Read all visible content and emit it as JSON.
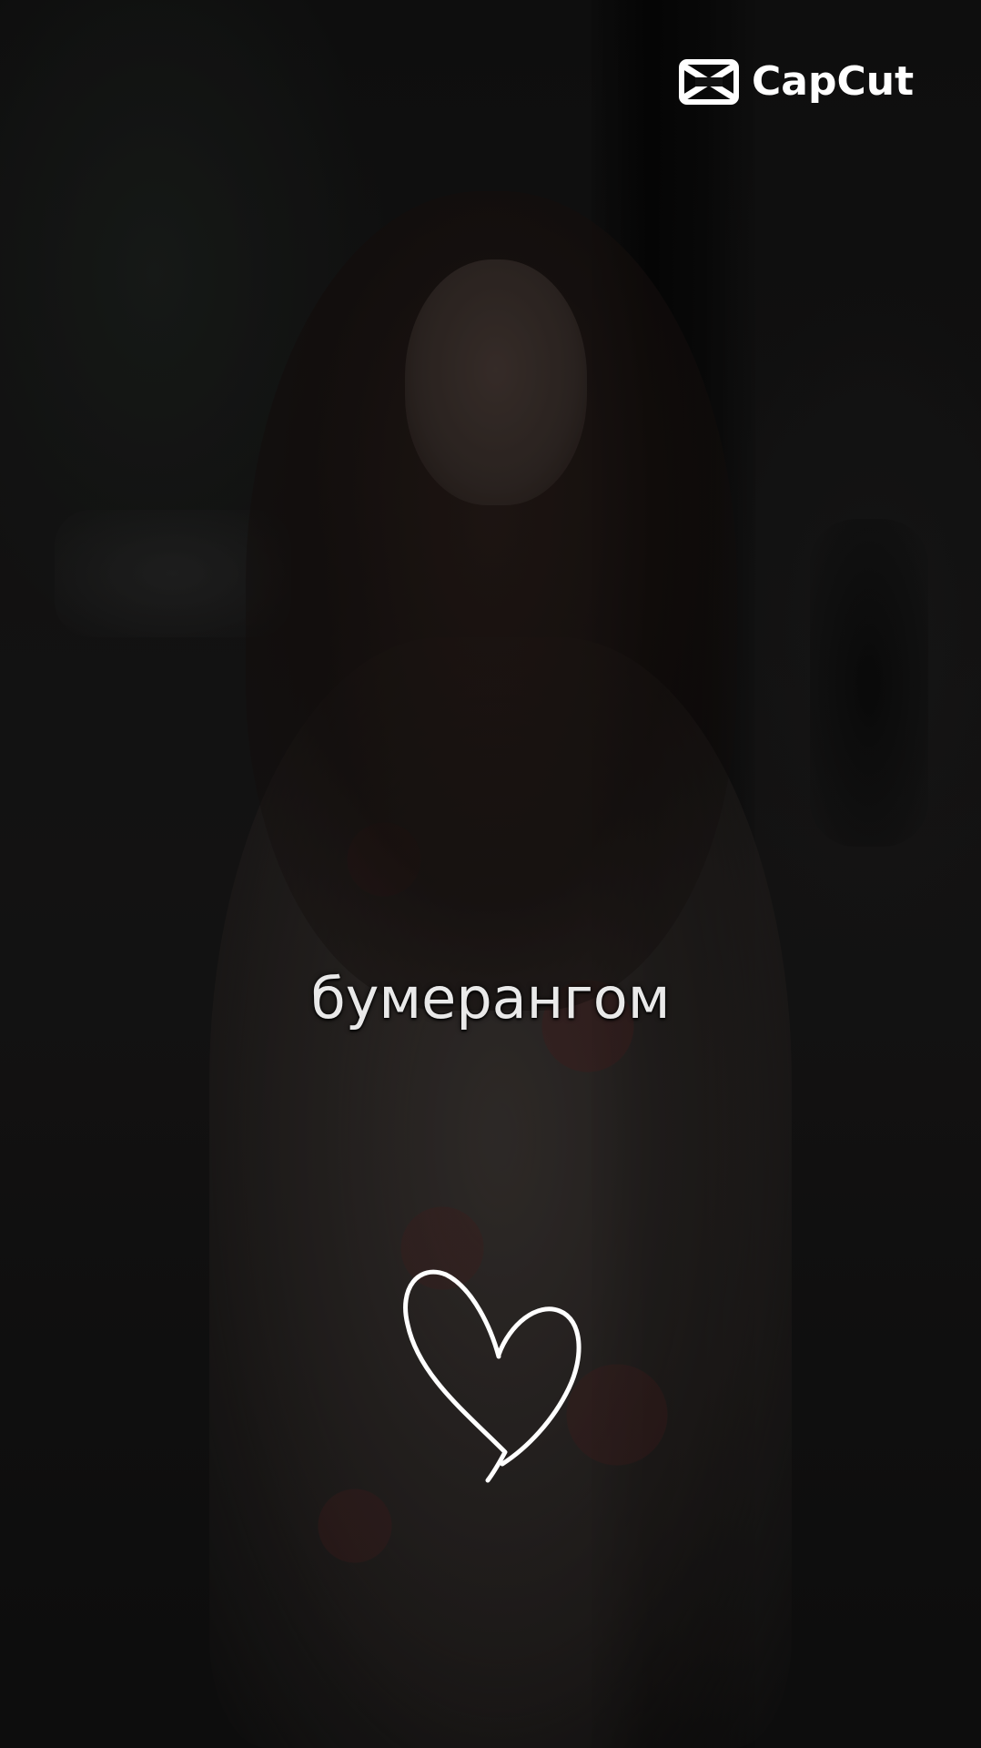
{
  "brand": {
    "logo_icon": "capcut-logo-icon",
    "name": "CapCut"
  },
  "caption": {
    "text": "бумерангом"
  },
  "decoration": {
    "icon": "heart-outline-icon",
    "color": "#ffffff"
  },
  "colors": {
    "text": "#e9e9e9",
    "logo": "#ffffff"
  }
}
